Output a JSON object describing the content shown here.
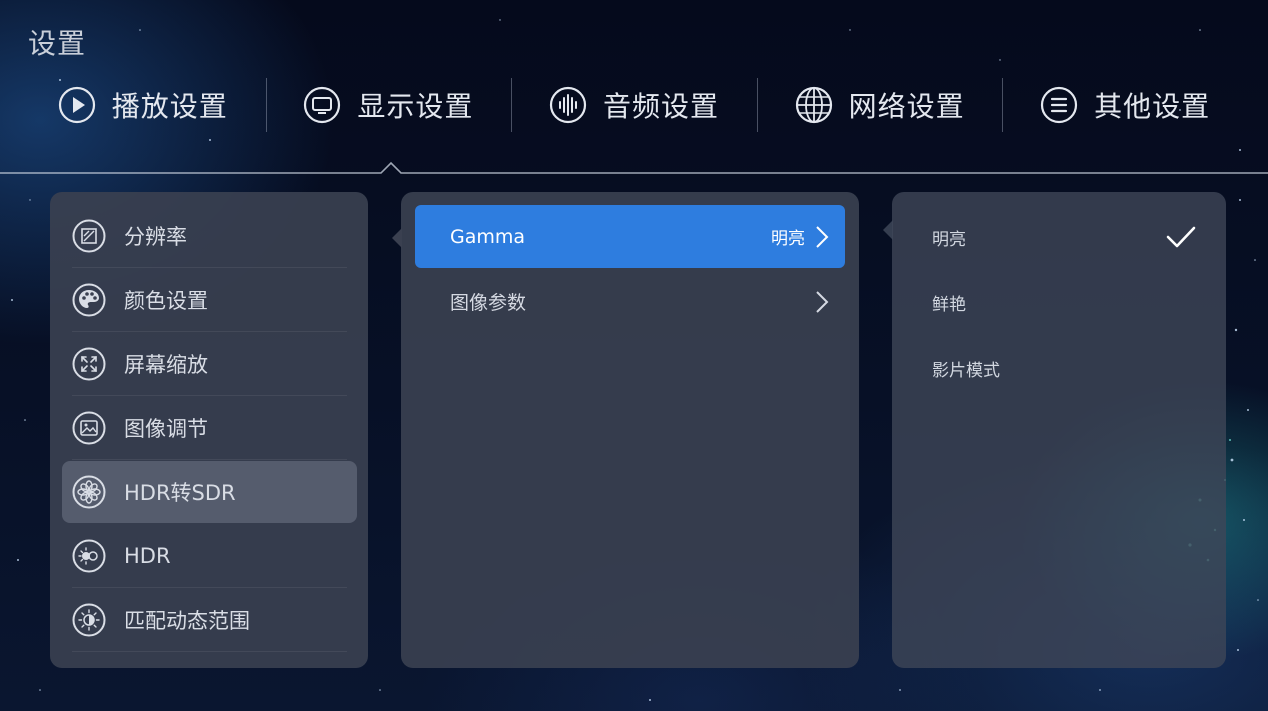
{
  "page_title": "设置",
  "tabs": [
    {
      "label": "播放设置",
      "icon": "play-circle-icon"
    },
    {
      "label": "显示设置",
      "icon": "monitor-icon"
    },
    {
      "label": "音频设置",
      "icon": "audio-wave-icon"
    },
    {
      "label": "网络设置",
      "icon": "globe-icon"
    },
    {
      "label": "其他设置",
      "icon": "menu-circle-icon"
    }
  ],
  "active_tab_index": 1,
  "display_menu": {
    "items": [
      {
        "label": "分辨率",
        "icon": "resolution-icon"
      },
      {
        "label": "颜色设置",
        "icon": "palette-icon"
      },
      {
        "label": "屏幕缩放",
        "icon": "screen-zoom-icon"
      },
      {
        "label": "图像调节",
        "icon": "image-adjust-icon"
      },
      {
        "label": "HDR转SDR",
        "icon": "hdr-to-sdr-icon"
      },
      {
        "label": "HDR",
        "icon": "hdr-icon"
      },
      {
        "label": "匹配动态范围",
        "icon": "dynamic-range-icon"
      }
    ],
    "selected_index": 4
  },
  "submenu": {
    "rows": [
      {
        "label": "Gamma",
        "value": "明亮"
      },
      {
        "label": "图像参数",
        "value": ""
      }
    ],
    "active_index": 0
  },
  "options": {
    "items": [
      {
        "label": "明亮",
        "checked": true
      },
      {
        "label": "鲜艳",
        "checked": false
      },
      {
        "label": "影片模式",
        "checked": false
      }
    ]
  },
  "colors": {
    "accent": "#2e7ddf",
    "panel": "#3a4050",
    "selected_item": "#555c6d"
  }
}
